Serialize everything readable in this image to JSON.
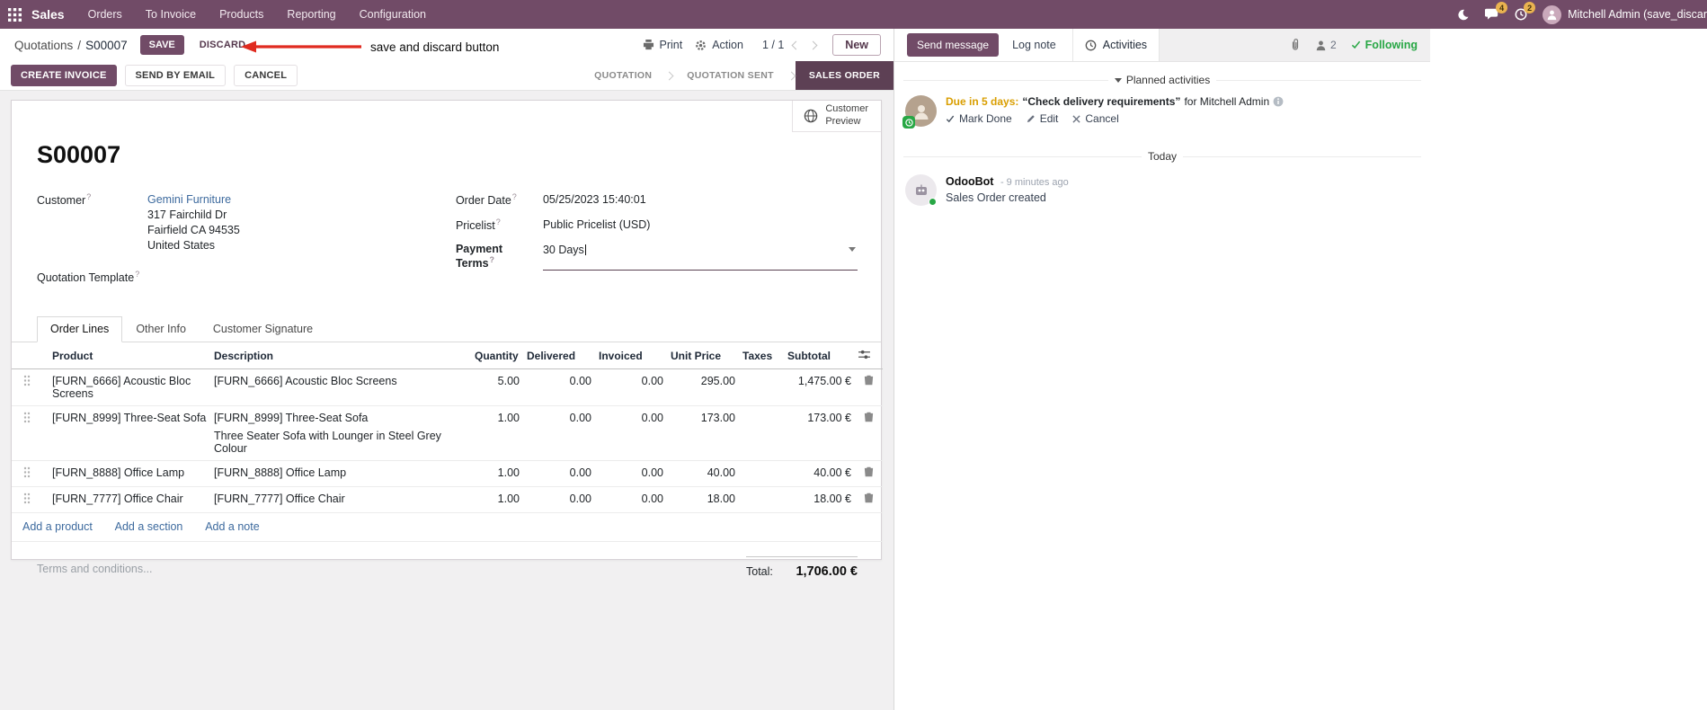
{
  "colors": {
    "brand": "#714B67",
    "link_blue": "#3d6a9e",
    "modified_blue": "#2e62ad",
    "due_orange": "#d99e00",
    "following_green": "#28a745",
    "annotation_red": "#e02b20",
    "badge_amber": "#eab350"
  },
  "topbar": {
    "app_name": "Sales",
    "menus": [
      "Orders",
      "To Invoice",
      "Products",
      "Reporting",
      "Configuration"
    ],
    "chat_badge": "4",
    "activity_badge": "2",
    "user_name": "Mitchell Admin (save_discar"
  },
  "control_panel": {
    "breadcrumb_parent": "Quotations",
    "breadcrumb_sep": "/",
    "breadcrumb_current": "S00007",
    "save_label": "SAVE",
    "discard_label": "DISCARD",
    "print_label": "Print",
    "action_label": "Action",
    "pager": "1 / 1",
    "new_label": "New"
  },
  "annotation": {
    "label": "save and discard button"
  },
  "statusbar": {
    "create_invoice": "CREATE INVOICE",
    "send_by_email": "SEND BY EMAIL",
    "cancel": "CANCEL",
    "stages": [
      {
        "label": "QUOTATION"
      },
      {
        "label": "QUOTATION SENT"
      },
      {
        "label": "SALES ORDER"
      }
    ]
  },
  "form": {
    "help_mark": "?",
    "preview_button": {
      "line1": "Customer",
      "line2": "Preview"
    },
    "title": "S00007",
    "customer": {
      "label": "Customer",
      "name": "Gemini Furniture",
      "address_line1": "317 Fairchild Dr",
      "address_line2": "Fairfield CA 94535",
      "address_line3": "United States"
    },
    "quotation_template_label": "Quotation Template",
    "order_date": {
      "label": "Order Date",
      "value": "05/25/2023 15:40:01"
    },
    "pricelist": {
      "label": "Pricelist",
      "value": "Public Pricelist (USD)"
    },
    "payment_terms": {
      "label": "Payment Terms",
      "value": "30 Days"
    },
    "tabs": [
      {
        "label": "Order Lines"
      },
      {
        "label": "Other Info"
      },
      {
        "label": "Customer Signature"
      }
    ],
    "order_lines": {
      "headers": {
        "product": "Product",
        "description": "Description",
        "quantity": "Quantity",
        "delivered": "Delivered",
        "invoiced": "Invoiced",
        "unit_price": "Unit Price",
        "taxes": "Taxes",
        "subtotal": "Subtotal"
      },
      "rows": [
        {
          "product": "[FURN_6666] Acoustic Bloc Screens",
          "description": "[FURN_6666] Acoustic Bloc Screens",
          "quantity": "5.00",
          "delivered": "0.00",
          "invoiced": "0.00",
          "unit_price": "295.00",
          "taxes": "",
          "subtotal": "1,475.00 €"
        },
        {
          "product": "[FURN_8999] Three-Seat Sofa",
          "description": "[FURN_8999] Three-Seat Sofa",
          "description2": "Three Seater Sofa with Lounger in Steel Grey Colour",
          "quantity": "1.00",
          "delivered": "0.00",
          "invoiced": "0.00",
          "unit_price": "173.00",
          "taxes": "",
          "subtotal": "173.00 €"
        },
        {
          "product": "[FURN_8888] Office Lamp",
          "description": "[FURN_8888] Office Lamp",
          "quantity": "1.00",
          "delivered": "0.00",
          "invoiced": "0.00",
          "unit_price": "40.00",
          "taxes": "",
          "subtotal": "40.00 €"
        },
        {
          "product": "[FURN_7777] Office Chair",
          "description": "[FURN_7777] Office Chair",
          "quantity": "1.00",
          "delivered": "0.00",
          "invoiced": "0.00",
          "unit_price": "18.00",
          "taxes": "",
          "subtotal": "18.00 €"
        }
      ],
      "add_product": "Add a product",
      "add_section": "Add a section",
      "add_note": "Add a note"
    },
    "terms_placeholder": "Terms and conditions...",
    "total": {
      "label": "Total:",
      "value": "1,706.00 €"
    }
  },
  "chatter": {
    "send_message": "Send message",
    "log_note": "Log note",
    "activities_tab": "Activities",
    "followers_count": "2",
    "following": "Following",
    "planned_activities": "Planned activities",
    "activity": {
      "due": "Due in 5 days:",
      "summary": "“Check delivery requirements”",
      "assignee": "for Mitchell Admin",
      "mark_done": "Mark Done",
      "edit": "Edit",
      "cancel": "Cancel"
    },
    "date_divider": "Today",
    "message": {
      "author": "OdooBot",
      "timestamp": "- 9 minutes ago",
      "body": "Sales Order created"
    }
  }
}
